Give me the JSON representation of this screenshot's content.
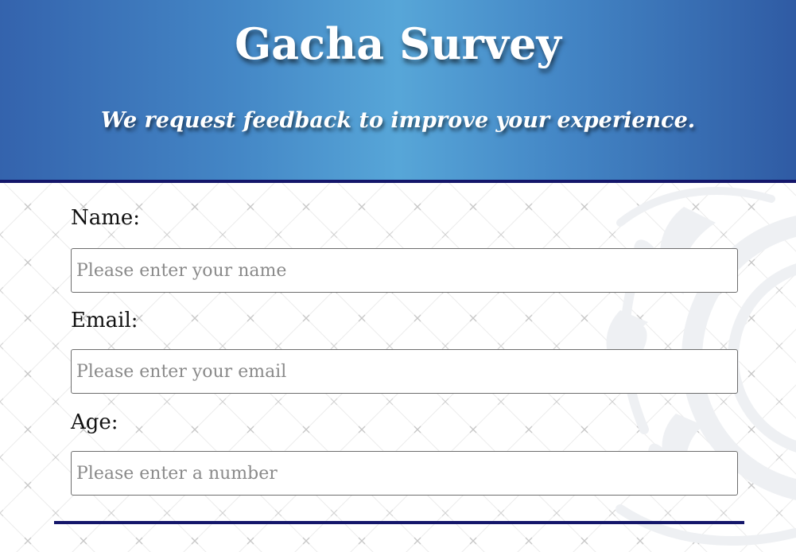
{
  "header": {
    "title": "Gacha Survey",
    "subtitle": "We request feedback to improve your experience."
  },
  "form": {
    "name": {
      "label": "Name:",
      "placeholder": "Please enter your name",
      "value": ""
    },
    "email": {
      "label": "Email:",
      "placeholder": "Please enter your email",
      "value": ""
    },
    "age": {
      "label": "Age:",
      "placeholder": "Please enter a number",
      "value": ""
    }
  },
  "colors": {
    "header_gradient_edge": "#3463ad",
    "header_gradient_center": "#57a6d8",
    "accent_navy": "#14166a",
    "input_border": "#6d6d6d",
    "placeholder_text": "#8a8a8a"
  },
  "icons": {
    "background_pattern": "cross-pattern",
    "background_emblem": "floral-emblem"
  }
}
